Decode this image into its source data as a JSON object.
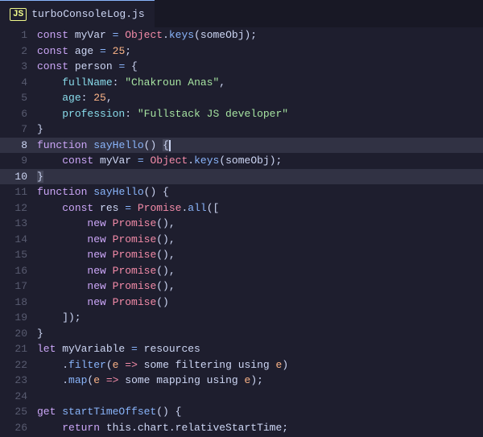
{
  "tab": {
    "icon": "JS",
    "filename": "turboConsoleLog.js"
  },
  "lines": [
    {
      "num": 1,
      "tokens": [
        {
          "t": "kw",
          "v": "const"
        },
        {
          "t": "plain",
          "v": " myVar "
        },
        {
          "t": "op",
          "v": "="
        },
        {
          "t": "plain",
          "v": " "
        },
        {
          "t": "obj",
          "v": "Object"
        },
        {
          "t": "plain",
          "v": "."
        },
        {
          "t": "method",
          "v": "keys"
        },
        {
          "t": "plain",
          "v": "(someObj);"
        }
      ]
    },
    {
      "num": 2,
      "tokens": [
        {
          "t": "kw",
          "v": "const"
        },
        {
          "t": "plain",
          "v": " age "
        },
        {
          "t": "op",
          "v": "="
        },
        {
          "t": "plain",
          "v": " "
        },
        {
          "t": "num",
          "v": "25"
        },
        {
          "t": "plain",
          "v": ";"
        }
      ]
    },
    {
      "num": 3,
      "tokens": [
        {
          "t": "kw",
          "v": "const"
        },
        {
          "t": "plain",
          "v": " person "
        },
        {
          "t": "op",
          "v": "="
        },
        {
          "t": "plain",
          "v": " {"
        }
      ]
    },
    {
      "num": 4,
      "tokens": [
        {
          "t": "plain",
          "v": "    "
        },
        {
          "t": "prop",
          "v": "fullName"
        },
        {
          "t": "plain",
          "v": ": "
        },
        {
          "t": "str",
          "v": "\"Chakroun Anas\""
        },
        {
          "t": "plain",
          "v": ","
        }
      ]
    },
    {
      "num": 5,
      "tokens": [
        {
          "t": "plain",
          "v": "    "
        },
        {
          "t": "prop",
          "v": "age"
        },
        {
          "t": "plain",
          "v": ": "
        },
        {
          "t": "num",
          "v": "25"
        },
        {
          "t": "plain",
          "v": ","
        }
      ]
    },
    {
      "num": 6,
      "tokens": [
        {
          "t": "plain",
          "v": "    "
        },
        {
          "t": "prop",
          "v": "profession"
        },
        {
          "t": "plain",
          "v": ": "
        },
        {
          "t": "str",
          "v": "\"Fullstack JS developer\""
        }
      ]
    },
    {
      "num": 7,
      "tokens": [
        {
          "t": "plain",
          "v": "}"
        }
      ]
    },
    {
      "num": 8,
      "tokens": [
        {
          "t": "kw",
          "v": "function"
        },
        {
          "t": "plain",
          "v": " "
        },
        {
          "t": "fn",
          "v": "sayHello"
        },
        {
          "t": "plain",
          "v": "() "
        },
        {
          "t": "bracket-match",
          "v": "{"
        }
      ],
      "active": true
    },
    {
      "num": 9,
      "tokens": [
        {
          "t": "plain",
          "v": "    "
        },
        {
          "t": "kw",
          "v": "const"
        },
        {
          "t": "plain",
          "v": " myVar "
        },
        {
          "t": "op",
          "v": "="
        },
        {
          "t": "plain",
          "v": " "
        },
        {
          "t": "obj",
          "v": "Object"
        },
        {
          "t": "plain",
          "v": "."
        },
        {
          "t": "method",
          "v": "keys"
        },
        {
          "t": "plain",
          "v": "(someObj);"
        }
      ]
    },
    {
      "num": 10,
      "tokens": [
        {
          "t": "bracket-match",
          "v": "}"
        }
      ],
      "active": true
    },
    {
      "num": 11,
      "tokens": [
        {
          "t": "kw",
          "v": "function"
        },
        {
          "t": "plain",
          "v": " "
        },
        {
          "t": "fn",
          "v": "sayHello"
        },
        {
          "t": "plain",
          "v": "() {"
        }
      ]
    },
    {
      "num": 12,
      "tokens": [
        {
          "t": "plain",
          "v": "    "
        },
        {
          "t": "kw",
          "v": "const"
        },
        {
          "t": "plain",
          "v": " res "
        },
        {
          "t": "op",
          "v": "="
        },
        {
          "t": "plain",
          "v": " "
        },
        {
          "t": "obj",
          "v": "Promise"
        },
        {
          "t": "plain",
          "v": "."
        },
        {
          "t": "method",
          "v": "all"
        },
        {
          "t": "plain",
          "v": "(["
        }
      ]
    },
    {
      "num": 13,
      "tokens": [
        {
          "t": "plain",
          "v": "        "
        },
        {
          "t": "kw",
          "v": "new"
        },
        {
          "t": "plain",
          "v": " "
        },
        {
          "t": "obj",
          "v": "Promise"
        },
        {
          "t": "plain",
          "v": "(),"
        }
      ]
    },
    {
      "num": 14,
      "tokens": [
        {
          "t": "plain",
          "v": "        "
        },
        {
          "t": "kw",
          "v": "new"
        },
        {
          "t": "plain",
          "v": " "
        },
        {
          "t": "obj",
          "v": "Promise"
        },
        {
          "t": "plain",
          "v": "(),"
        }
      ]
    },
    {
      "num": 15,
      "tokens": [
        {
          "t": "plain",
          "v": "        "
        },
        {
          "t": "kw",
          "v": "new"
        },
        {
          "t": "plain",
          "v": " "
        },
        {
          "t": "obj",
          "v": "Promise"
        },
        {
          "t": "plain",
          "v": "(),"
        }
      ]
    },
    {
      "num": 16,
      "tokens": [
        {
          "t": "plain",
          "v": "        "
        },
        {
          "t": "kw",
          "v": "new"
        },
        {
          "t": "plain",
          "v": " "
        },
        {
          "t": "obj",
          "v": "Promise"
        },
        {
          "t": "plain",
          "v": "(),"
        }
      ]
    },
    {
      "num": 17,
      "tokens": [
        {
          "t": "plain",
          "v": "        "
        },
        {
          "t": "kw",
          "v": "new"
        },
        {
          "t": "plain",
          "v": " "
        },
        {
          "t": "obj",
          "v": "Promise"
        },
        {
          "t": "plain",
          "v": "(),"
        }
      ]
    },
    {
      "num": 18,
      "tokens": [
        {
          "t": "plain",
          "v": "        "
        },
        {
          "t": "kw",
          "v": "new"
        },
        {
          "t": "plain",
          "v": " "
        },
        {
          "t": "obj",
          "v": "Promise"
        },
        {
          "t": "plain",
          "v": "()"
        }
      ]
    },
    {
      "num": 19,
      "tokens": [
        {
          "t": "plain",
          "v": "    ]);"
        }
      ]
    },
    {
      "num": 20,
      "tokens": [
        {
          "t": "plain",
          "v": "}"
        }
      ]
    },
    {
      "num": 21,
      "tokens": [
        {
          "t": "kw",
          "v": "let"
        },
        {
          "t": "plain",
          "v": " myVariable "
        },
        {
          "t": "op",
          "v": "="
        },
        {
          "t": "plain",
          "v": " resources"
        }
      ]
    },
    {
      "num": 22,
      "tokens": [
        {
          "t": "plain",
          "v": "    ."
        },
        {
          "t": "method",
          "v": "filter"
        },
        {
          "t": "plain",
          "v": "("
        },
        {
          "t": "param",
          "v": "e"
        },
        {
          "t": "plain",
          "v": " "
        },
        {
          "t": "arrow",
          "v": "=>"
        },
        {
          "t": "plain",
          "v": " some filtering using "
        },
        {
          "t": "param",
          "v": "e"
        },
        {
          "t": "plain",
          "v": ")"
        }
      ]
    },
    {
      "num": 23,
      "tokens": [
        {
          "t": "plain",
          "v": "    ."
        },
        {
          "t": "method",
          "v": "map"
        },
        {
          "t": "plain",
          "v": "("
        },
        {
          "t": "param",
          "v": "e"
        },
        {
          "t": "plain",
          "v": " "
        },
        {
          "t": "arrow",
          "v": "=>"
        },
        {
          "t": "plain",
          "v": " some mapping using "
        },
        {
          "t": "param",
          "v": "e"
        },
        {
          "t": "plain",
          "v": ");"
        }
      ]
    },
    {
      "num": 24,
      "tokens": []
    },
    {
      "num": 25,
      "tokens": [
        {
          "t": "kw",
          "v": "get"
        },
        {
          "t": "plain",
          "v": " "
        },
        {
          "t": "fn",
          "v": "startTimeOffset"
        },
        {
          "t": "plain",
          "v": "() {"
        }
      ]
    },
    {
      "num": 26,
      "tokens": [
        {
          "t": "plain",
          "v": "    "
        },
        {
          "t": "kw",
          "v": "return"
        },
        {
          "t": "plain",
          "v": " this.chart.relativeStartTime;"
        }
      ]
    }
  ]
}
